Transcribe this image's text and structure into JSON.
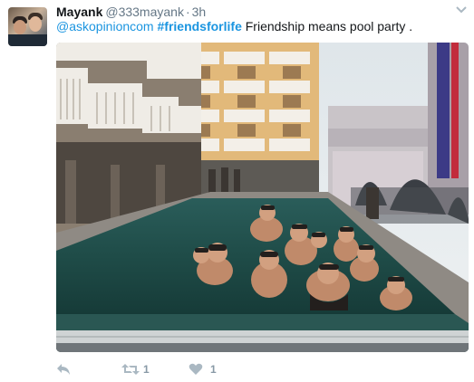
{
  "tweet": {
    "author": {
      "name": "Mayank",
      "handle": "@333mayank",
      "separator": "·",
      "time": "3h",
      "avatar_icon": "profile-photo"
    },
    "text": {
      "mention": "@askopinioncom",
      "hashtag": "#friendsforlife",
      "body": "Friendship means pool party ."
    },
    "media": {
      "type": "photo",
      "description_icon": "pool-party-photo"
    },
    "actions": {
      "reply_icon": "reply-icon",
      "retweet_icon": "retweet-icon",
      "retweet_count": "1",
      "like_icon": "heart-icon",
      "like_count": "1"
    },
    "colors": {
      "link": "#1b95e0",
      "muted": "#657786",
      "action": "#8899a6"
    }
  }
}
